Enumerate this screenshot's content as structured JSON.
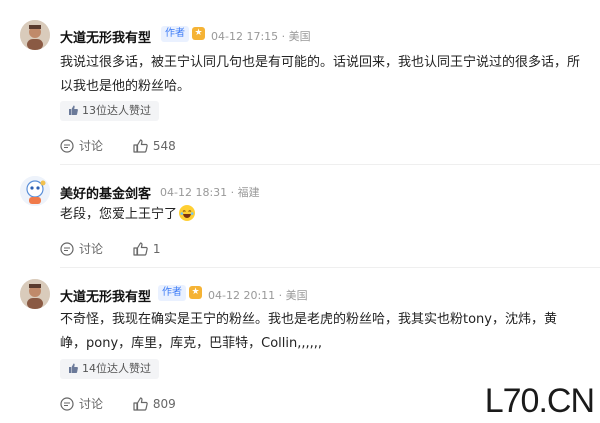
{
  "comments": [
    {
      "author": "大道无形我有型",
      "author_tag": "作者",
      "time": "04-12 17:15",
      "location": "美国",
      "text": "我说过很多话，被王宁认同几句也是有可能的。话说回来，我也认同王宁说过的很多话，所以我也是他的粉丝哈。",
      "expert_likes": "13位达人赞过",
      "discuss_label": "讨论",
      "like_count": "548"
    },
    {
      "author": "美好的基金剑客",
      "time": "04-12 18:31",
      "location": "福建",
      "text": "老段，您爱上王宁了",
      "discuss_label": "讨论",
      "like_count": "1"
    },
    {
      "author": "大道无形我有型",
      "author_tag": "作者",
      "time": "04-12 20:11",
      "location": "美国",
      "text": "不奇怪，我现在确实是王宁的粉丝。我也是老虎的粉丝哈，我其实也粉tony，沈炜，黄峥，pony，库里，库克，巴菲特，Collin,,,,,,",
      "expert_likes": "14位达人赞过",
      "discuss_label": "讨论",
      "like_count": "809"
    }
  ],
  "watermark": "L70.CN",
  "icons": {
    "avatar_1": "portrait-avatar",
    "avatar_2": "robot-avatar",
    "medal": "medal-icon",
    "discuss": "comment-bubble-icon",
    "like": "thumbs-up-icon",
    "expert_like": "thumbs-up-icon",
    "emoji": "laughing-emoji-icon"
  }
}
